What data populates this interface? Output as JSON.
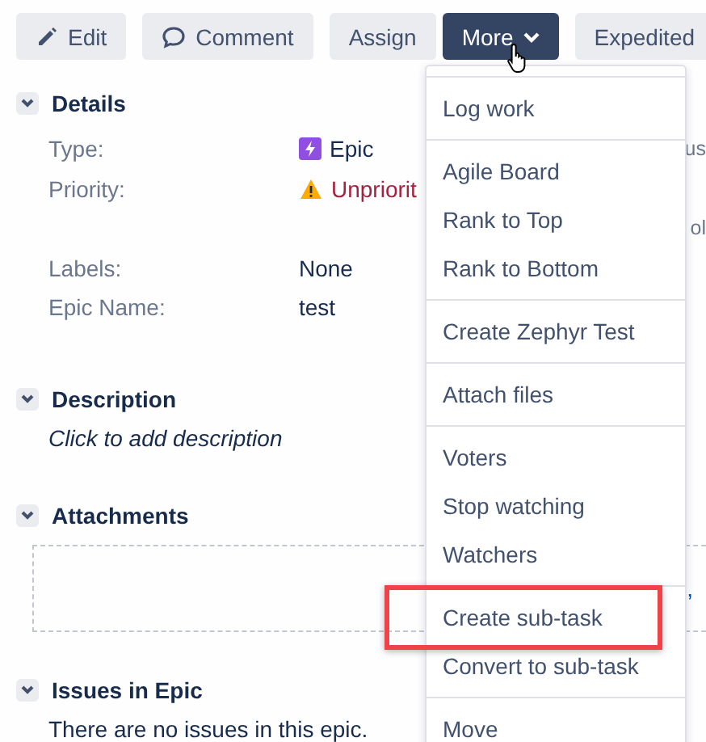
{
  "toolbar": {
    "buttons": [
      {
        "label": "Edit",
        "kind": "edit",
        "pressed": false
      },
      {
        "label": "Comment",
        "kind": "comment",
        "pressed": false
      },
      {
        "label": "Assign",
        "kind": "plain",
        "pressed": false
      },
      {
        "label": "More",
        "kind": "menu",
        "pressed": true
      },
      {
        "label": "Expedited",
        "kind": "plain",
        "pressed": false
      }
    ]
  },
  "details": {
    "title": "Details",
    "expanded": true,
    "fields": [
      {
        "label": "Type:",
        "value": "Epic",
        "kind": "issue-type",
        "side_text": "us"
      },
      {
        "label": "Priority:",
        "value": "Unpriorit",
        "kind": "priority"
      },
      {
        "kind": "blank",
        "side_text": "ol"
      },
      {
        "label": "Labels:",
        "value": "None",
        "kind": "text"
      },
      {
        "label": "Epic Name:",
        "value": "test",
        "kind": "text"
      }
    ]
  },
  "description": {
    "title": "Description",
    "expanded": true,
    "placeholder": "Click to add description"
  },
  "attachments": {
    "title": "Attachments",
    "expanded": true,
    "drop_text": ","
  },
  "issues_in_epic": {
    "title": "Issues in Epic",
    "expanded": true,
    "text": "There are no issues in this epic."
  },
  "menu": {
    "groups": [
      [
        {
          "label": "Log work",
          "highlighted": false
        }
      ],
      [
        {
          "label": "Agile Board",
          "highlighted": false
        },
        {
          "label": "Rank to Top",
          "highlighted": false
        },
        {
          "label": "Rank to Bottom",
          "highlighted": false
        }
      ],
      [
        {
          "label": "Create Zephyr Test",
          "highlighted": false
        }
      ],
      [
        {
          "label": "Attach files",
          "highlighted": false
        }
      ],
      [
        {
          "label": "Voters",
          "highlighted": false
        },
        {
          "label": "Stop watching",
          "highlighted": false
        },
        {
          "label": "Watchers",
          "highlighted": false
        }
      ],
      [
        {
          "label": "Create sub-task",
          "highlighted": true
        },
        {
          "label": "Convert to sub-task",
          "highlighted": false
        }
      ],
      [
        {
          "label": "Move",
          "highlighted": false
        }
      ]
    ]
  }
}
